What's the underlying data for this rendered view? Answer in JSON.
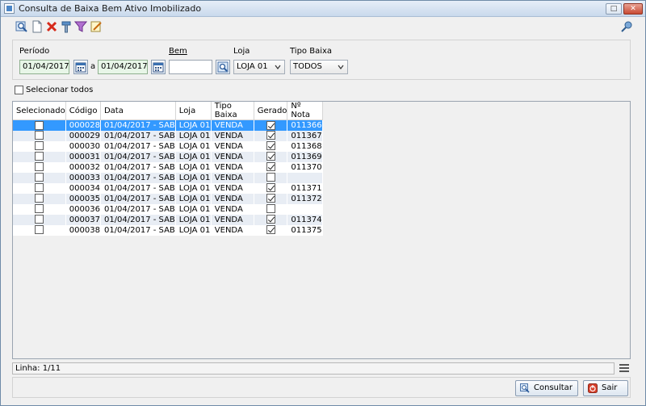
{
  "window": {
    "title": "Consulta de Baixa Bem Ativo Imobilizado"
  },
  "filters": {
    "periodo_label": "Período",
    "date_from": "01/04/2017",
    "date_sep": "a",
    "date_to": "01/04/2017",
    "bem_label": "Bem",
    "bem_value": "",
    "loja_label": "Loja",
    "loja_value": "LOJA 01",
    "tipo_label": "Tipo Baixa",
    "tipo_value": "TODOS"
  },
  "select_all_label": "Selecionar todos",
  "table": {
    "columns": [
      "Selecionado",
      "Código",
      "Data",
      "Loja",
      "Tipo Baixa",
      "Gerado",
      "Nº Nota"
    ],
    "rows": [
      {
        "selected": false,
        "codigo": "000028",
        "data": "01/04/2017 - SAB",
        "loja": "LOJA 01",
        "tipo": "VENDA",
        "gerado": true,
        "nota": "011366"
      },
      {
        "selected": false,
        "codigo": "000029",
        "data": "01/04/2017 - SAB",
        "loja": "LOJA 01",
        "tipo": "VENDA",
        "gerado": true,
        "nota": "011367"
      },
      {
        "selected": false,
        "codigo": "000030",
        "data": "01/04/2017 - SAB",
        "loja": "LOJA 01",
        "tipo": "VENDA",
        "gerado": true,
        "nota": "011368"
      },
      {
        "selected": false,
        "codigo": "000031",
        "data": "01/04/2017 - SAB",
        "loja": "LOJA 01",
        "tipo": "VENDA",
        "gerado": true,
        "nota": "011369"
      },
      {
        "selected": false,
        "codigo": "000032",
        "data": "01/04/2017 - SAB",
        "loja": "LOJA 01",
        "tipo": "VENDA",
        "gerado": true,
        "nota": "011370"
      },
      {
        "selected": false,
        "codigo": "000033",
        "data": "01/04/2017 - SAB",
        "loja": "LOJA 01",
        "tipo": "VENDA",
        "gerado": false,
        "nota": ""
      },
      {
        "selected": false,
        "codigo": "000034",
        "data": "01/04/2017 - SAB",
        "loja": "LOJA 01",
        "tipo": "VENDA",
        "gerado": true,
        "nota": "011371"
      },
      {
        "selected": false,
        "codigo": "000035",
        "data": "01/04/2017 - SAB",
        "loja": "LOJA 01",
        "tipo": "VENDA",
        "gerado": true,
        "nota": "011372"
      },
      {
        "selected": false,
        "codigo": "000036",
        "data": "01/04/2017 - SAB",
        "loja": "LOJA 01",
        "tipo": "VENDA",
        "gerado": false,
        "nota": ""
      },
      {
        "selected": false,
        "codigo": "000037",
        "data": "01/04/2017 - SAB",
        "loja": "LOJA 01",
        "tipo": "VENDA",
        "gerado": true,
        "nota": "011374"
      },
      {
        "selected": false,
        "codigo": "000038",
        "data": "01/04/2017 - SAB",
        "loja": "LOJA 01",
        "tipo": "VENDA",
        "gerado": true,
        "nota": "011375"
      }
    ]
  },
  "status": {
    "linha": "Linha: 1/11"
  },
  "buttons": {
    "consultar": "Consultar",
    "sair": "Sair"
  },
  "colors": {
    "selection": "#3399ff",
    "alt_row": "#e8edf4",
    "date_field": "#e8f6e8"
  },
  "icons": [
    "search-icon",
    "new-doc-icon",
    "delete-icon",
    "tools-icon",
    "filter-icon",
    "edit-icon",
    "key-icon",
    "calendar-icon",
    "lookup-icon",
    "menu-icon",
    "exit-icon"
  ]
}
